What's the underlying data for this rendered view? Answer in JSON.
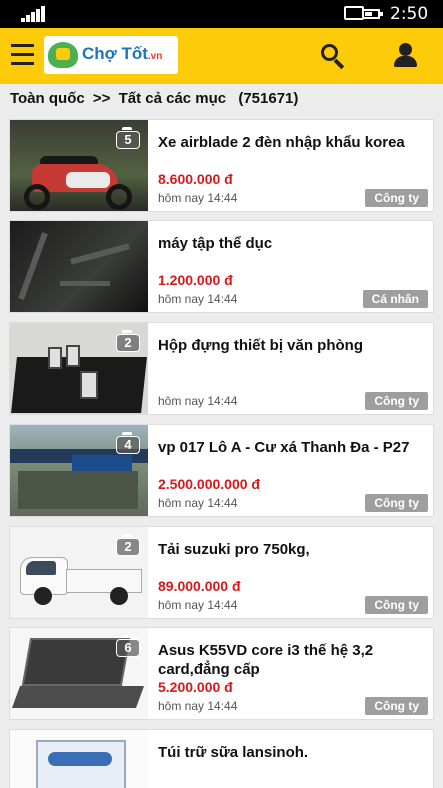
{
  "status_bar": {
    "time": "2:50",
    "battery_level": 0.6
  },
  "header": {
    "logo_text": "Chợ Tốt",
    "logo_suffix": ".vn",
    "menu_icon": "hamburger-icon",
    "search_icon": "search-icon",
    "user_icon": "user-icon",
    "brand_color": "#fecb0b"
  },
  "breadcrumb": {
    "region": "Toàn quốc",
    "separator": ">>",
    "category": "Tất cả các mục",
    "count": "(751671)"
  },
  "listings": [
    {
      "title": "Xe airblade 2 đèn nhập khẩu korea",
      "price": "8.600.000 đ",
      "posted": "hôm nay 14:44",
      "seller": "Công ty",
      "photos": "5"
    },
    {
      "title": "máy tập thể dục",
      "price": "1.200.000 đ",
      "posted": "hôm nay 14:44",
      "seller": "Cá nhân",
      "photos": ""
    },
    {
      "title": "Hộp đựng thiết bị văn phòng",
      "price": "",
      "posted": "hôm nay 14:44",
      "seller": "Công ty",
      "photos": "2"
    },
    {
      "title": "vp 017 Lô A - Cư xá Thanh Đa - P27",
      "price": "2.500.000.000 đ",
      "posted": "hôm nay 14:44",
      "seller": "Công ty",
      "photos": "4"
    },
    {
      "title": "Tải suzuki pro 750kg,",
      "price": "89.000.000 đ",
      "posted": "hôm nay 14:44",
      "seller": "Công ty",
      "photos": "2"
    },
    {
      "title": "Asus K55VD core i3 thế hệ 3,2 card,đẳng cấp",
      "price": "5.200.000 đ",
      "posted": "hôm nay 14:44",
      "seller": "Công ty",
      "photos": "6"
    },
    {
      "title": "Túi trữ sữa lansinoh.",
      "price": "",
      "posted": "",
      "seller": "",
      "photos": ""
    }
  ],
  "colors": {
    "price": "#d7191c",
    "badge": "#9e9e9e",
    "background": "#ececec"
  }
}
